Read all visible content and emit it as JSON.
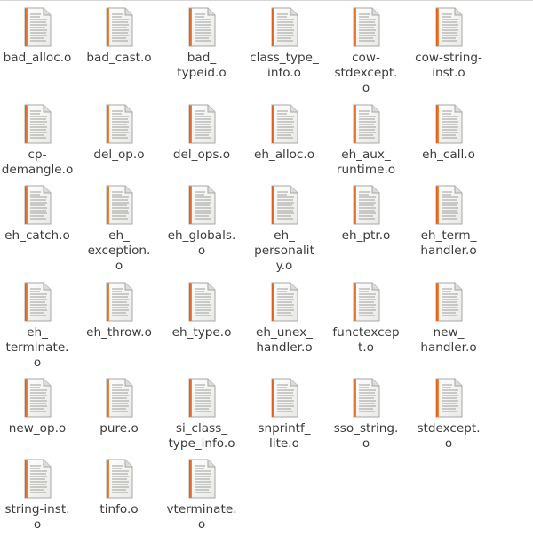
{
  "view": {
    "icon": "text-document-icon"
  },
  "files": [
    {
      "name": "bad_alloc.o"
    },
    {
      "name": "bad_cast.o"
    },
    {
      "name": "bad_\ntypeid.o"
    },
    {
      "name": "class_type_\ninfo.o"
    },
    {
      "name": "cow-\nstdexcept.\no"
    },
    {
      "name": "cow-string-\ninst.o"
    },
    {
      "name": "cp-\ndemangle.o"
    },
    {
      "name": "del_op.o"
    },
    {
      "name": "del_ops.o"
    },
    {
      "name": "eh_alloc.o"
    },
    {
      "name": "eh_aux_\nruntime.o"
    },
    {
      "name": "eh_call.o"
    },
    {
      "name": "eh_catch.o"
    },
    {
      "name": "eh_\nexception.\no"
    },
    {
      "name": "eh_globals.\no"
    },
    {
      "name": "eh_\npersonalit\ny.o"
    },
    {
      "name": "eh_ptr.o"
    },
    {
      "name": "eh_term_\nhandler.o"
    },
    {
      "name": "eh_\nterminate.\no"
    },
    {
      "name": "eh_throw.o"
    },
    {
      "name": "eh_type.o"
    },
    {
      "name": "eh_unex_\nhandler.o"
    },
    {
      "name": "functexcep\nt.o"
    },
    {
      "name": "new_\nhandler.o"
    },
    {
      "name": "new_op.o"
    },
    {
      "name": "pure.o"
    },
    {
      "name": "si_class_\ntype_info.o"
    },
    {
      "name": "snprintf_\nlite.o"
    },
    {
      "name": "sso_string.\no"
    },
    {
      "name": "stdexcept.\no"
    },
    {
      "name": "string-inst.\no"
    },
    {
      "name": "tinfo.o"
    },
    {
      "name": "vterminate.\no"
    }
  ]
}
